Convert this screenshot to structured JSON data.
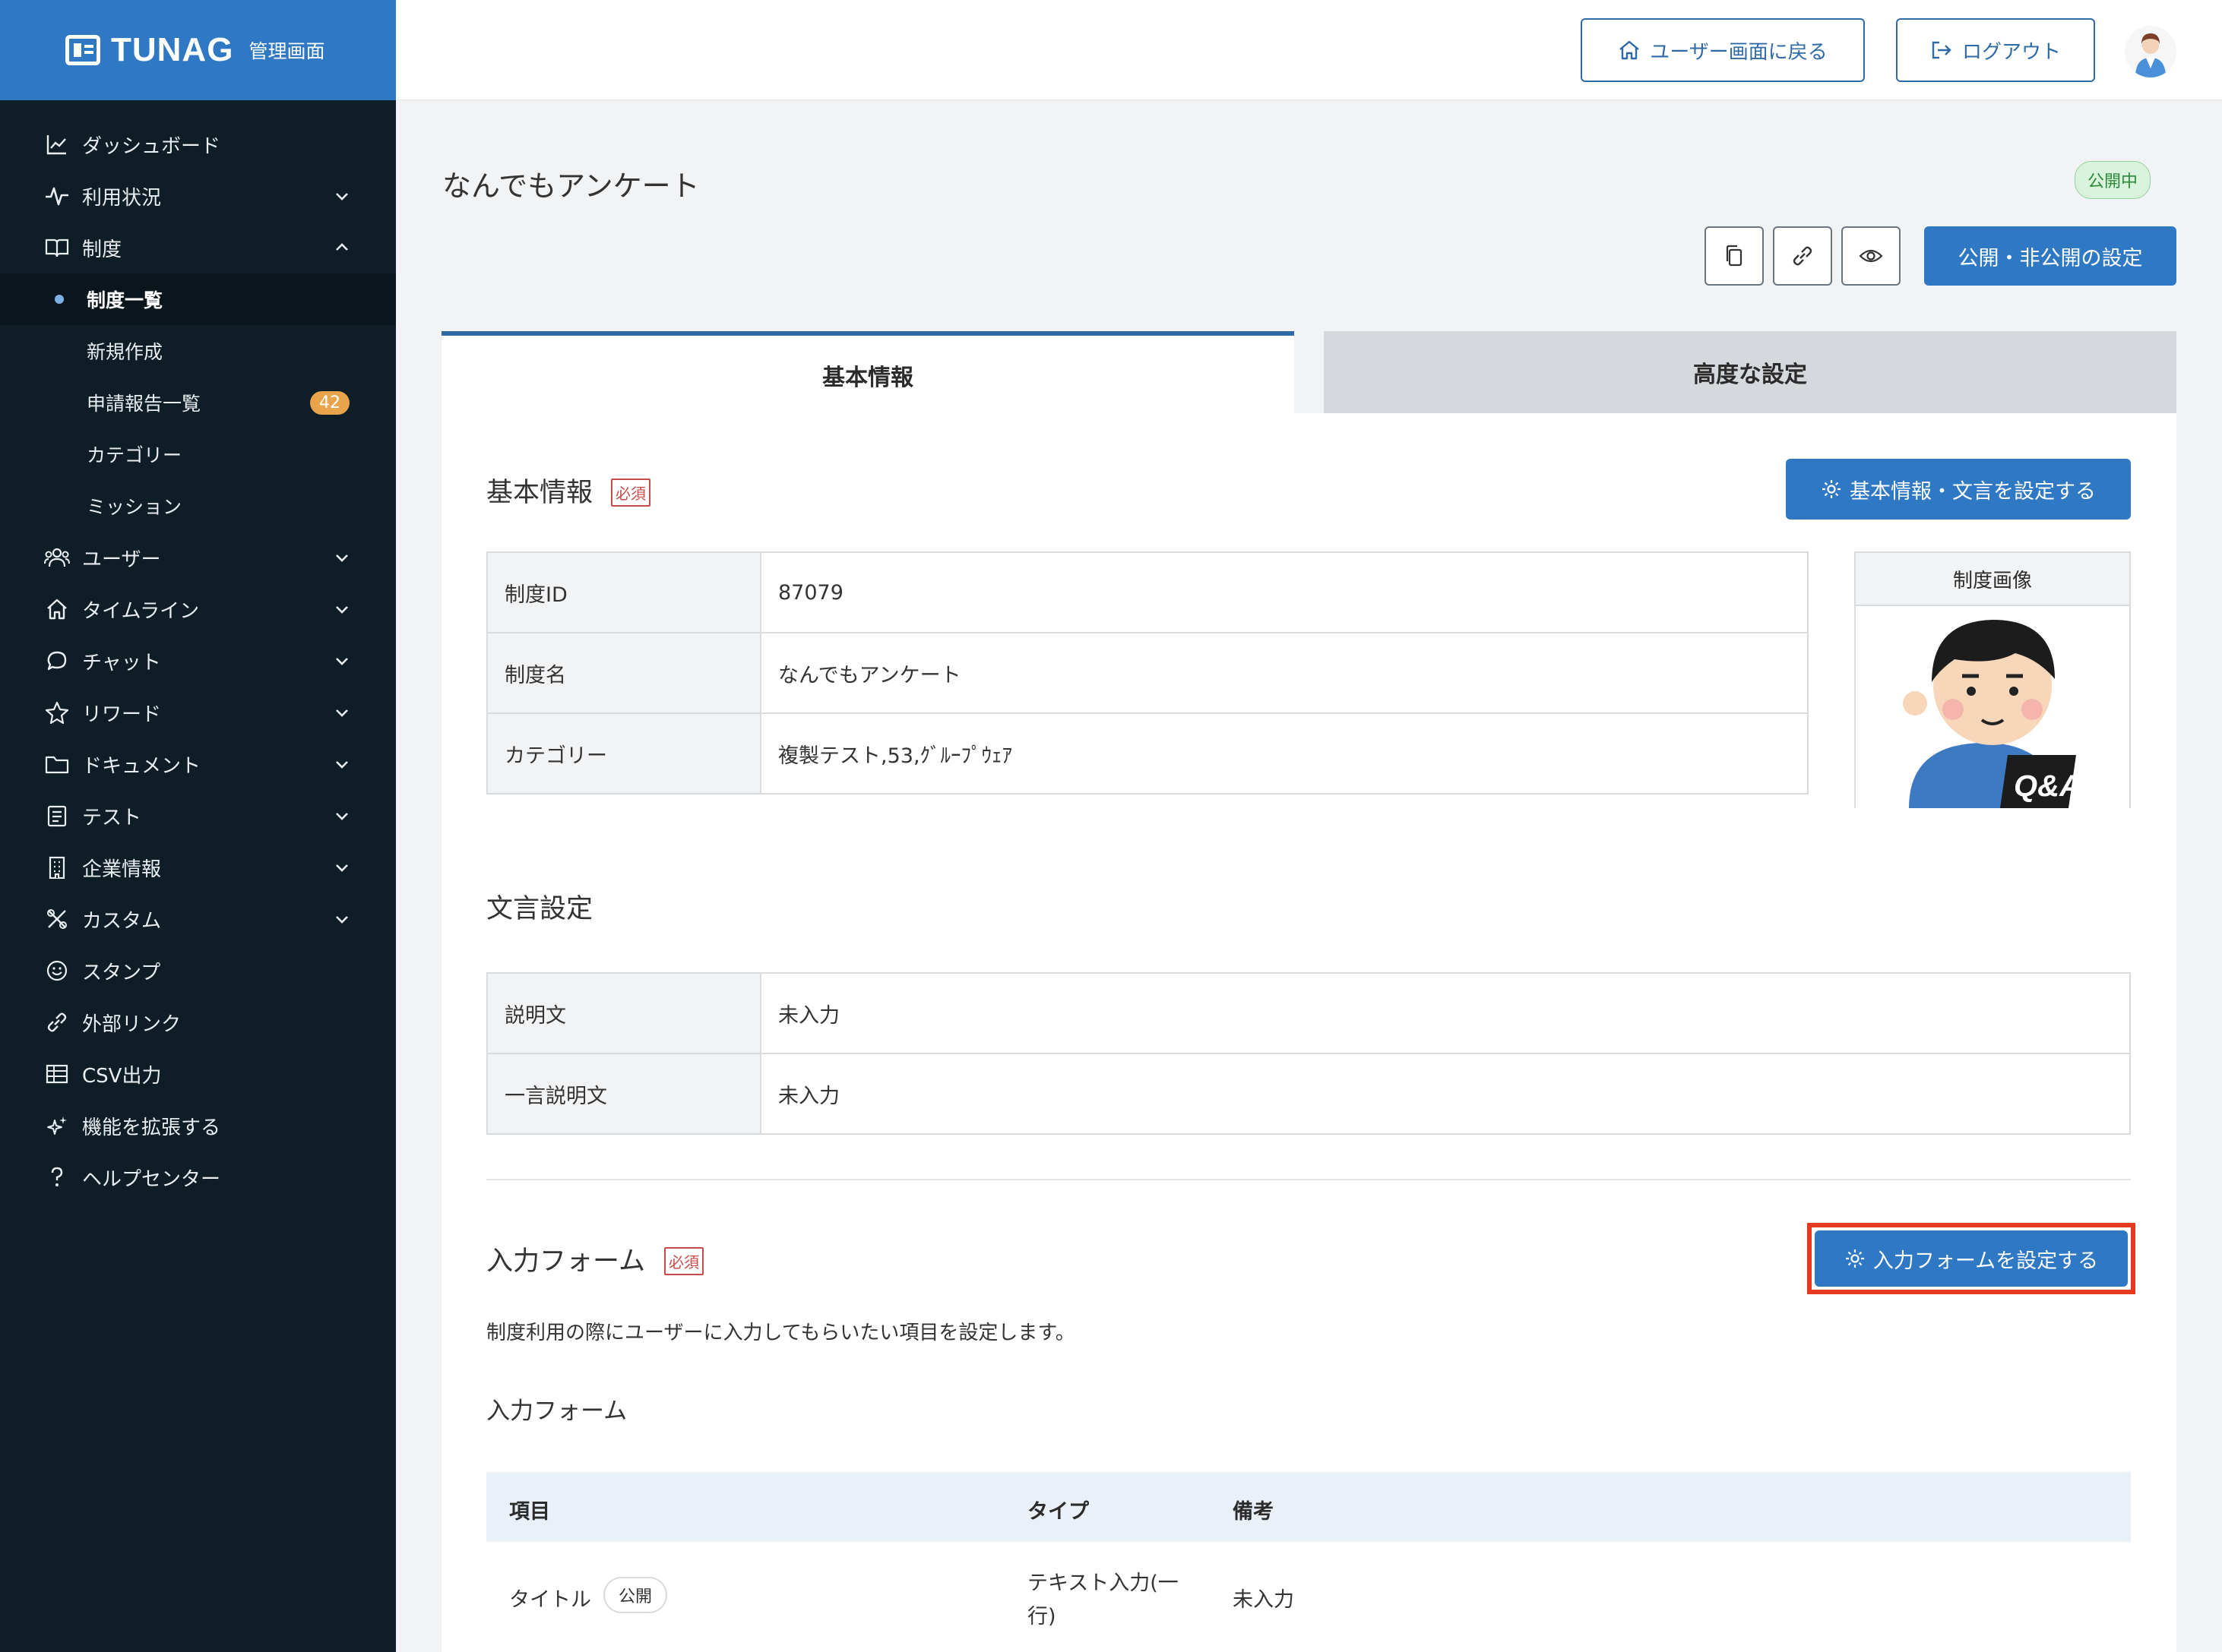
{
  "app": {
    "logo": "TUNAG",
    "logo_sub": "管理画面"
  },
  "sidebar": {
    "items": [
      {
        "label": "ダッシュボード",
        "icon": "chart-line-icon",
        "chevron": ""
      },
      {
        "label": "利用状況",
        "icon": "activity-icon",
        "chevron": "down"
      },
      {
        "label": "制度",
        "icon": "book-icon",
        "chevron": "up"
      }
    ],
    "sub_items": [
      {
        "label": "制度一覧",
        "active": true
      },
      {
        "label": "新規作成"
      },
      {
        "label": "申請報告一覧",
        "badge": "42"
      },
      {
        "label": "カテゴリー"
      },
      {
        "label": "ミッション"
      }
    ],
    "items_after": [
      {
        "label": "ユーザー",
        "icon": "users-icon",
        "chevron": "down"
      },
      {
        "label": "タイムライン",
        "icon": "home-icon",
        "chevron": "down"
      },
      {
        "label": "チャット",
        "icon": "chat-icon",
        "chevron": "down"
      },
      {
        "label": "リワード",
        "icon": "star-icon",
        "chevron": "down"
      },
      {
        "label": "ドキュメント",
        "icon": "folder-icon",
        "chevron": "down"
      },
      {
        "label": "テスト",
        "icon": "checklist-icon",
        "chevron": "down"
      },
      {
        "label": "企業情報",
        "icon": "building-icon",
        "chevron": "down"
      },
      {
        "label": "カスタム",
        "icon": "tools-icon",
        "chevron": "down"
      },
      {
        "label": "スタンプ",
        "icon": "smile-icon",
        "chevron": ""
      },
      {
        "label": "外部リンク",
        "icon": "link-icon",
        "chevron": ""
      },
      {
        "label": "CSV出力",
        "icon": "table-icon",
        "chevron": ""
      },
      {
        "label": "機能を拡張する",
        "icon": "sparkle-icon",
        "chevron": ""
      },
      {
        "label": "ヘルプセンター",
        "icon": "question-icon",
        "chevron": ""
      }
    ]
  },
  "header": {
    "back_label": "ユーザー画面に戻る",
    "logout_label": "ログアウト"
  },
  "page": {
    "title": "なんでもアンケート",
    "status": "公開中",
    "publish_button": "公開・非公開の設定",
    "tabs": [
      "基本情報",
      "高度な設定"
    ]
  },
  "basic": {
    "title": "基本情報",
    "required": "必須",
    "button": "基本情報・文言を設定する",
    "rows": [
      {
        "label": "制度ID",
        "value": "87079"
      },
      {
        "label": "制度名",
        "value": "なんでもアンケート"
      },
      {
        "label": "カテゴリー",
        "value": "複製テスト,53,ｸﾞﾙｰﾌﾟｳｪｱ"
      }
    ],
    "image_label": "制度画像",
    "image_caption": "Q&A"
  },
  "wording": {
    "title": "文言設定",
    "rows": [
      {
        "label": "説明文",
        "value": "未入力"
      },
      {
        "label": "一言説明文",
        "value": "未入力"
      }
    ]
  },
  "form": {
    "title": "入力フォーム",
    "required": "必須",
    "button": "入力フォームを設定する",
    "description": "制度利用の際にユーザーに入力してもらいたい項目を設定します。",
    "subtitle": "入力フォーム",
    "columns": [
      "項目",
      "タイプ",
      "備考"
    ],
    "rows": [
      {
        "item": "タイトル",
        "pill": "公開",
        "type_line1": "テキスト入力(一",
        "type_line2": "行)",
        "note": "未入力"
      }
    ]
  },
  "colors": {
    "accent": "#2f78c4",
    "sidebar_bg": "#0f1e26",
    "highlight": "#e53a1f",
    "status_green": "#2c8a3a"
  }
}
